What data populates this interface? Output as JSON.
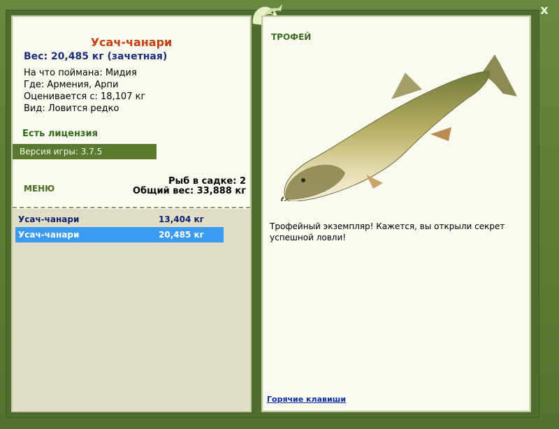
{
  "window": {
    "close_glyph": "x"
  },
  "fish": {
    "name": "Усач-чанари",
    "weight_line": "Вес: 20,485 кг (зачетная)",
    "caught_on": "На что поймана: Мидия",
    "location": "Где: Армения, Арпи",
    "rated_from": "Оценивается с: 18,107 кг",
    "kind": "Вид: Ловится редко"
  },
  "license": "Есть лицензия",
  "version": "Версия игры: 3.7.5",
  "menu_label": "МЕНЮ",
  "cage": {
    "count_line": "Рыб в садке: 2",
    "total_line": "Общий вес: 33,888 кг"
  },
  "catches": [
    {
      "name": "Усач-чанари",
      "weight": "13,404 кг",
      "selected": false
    },
    {
      "name": "Усач-чанари",
      "weight": "20,485 кг",
      "selected": true
    }
  ],
  "trophy": {
    "label": "ТРОФЕЙ",
    "text": "Трофейный экземпляр! Кажется, вы открыли секрет успешной ловли!",
    "hotkeys": "Горячие клавиши"
  },
  "icons": {
    "logo": "fish-logo-icon",
    "close": "close-icon"
  }
}
